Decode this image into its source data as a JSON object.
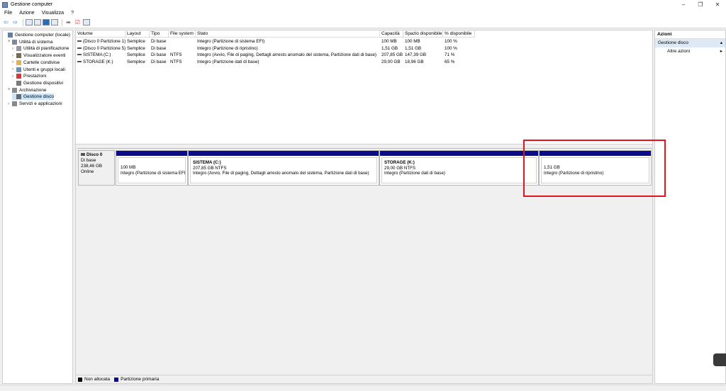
{
  "window": {
    "title": "Gestione computer"
  },
  "menu": [
    "File",
    "Azione",
    "Visualizza",
    "?"
  ],
  "tree": [
    {
      "label": "Gestione computer (locale)",
      "indent": 0,
      "exp": "",
      "color": "#5e7fa6"
    },
    {
      "label": "Utilità di sistema",
      "indent": 1,
      "exp": "˅",
      "color": "#7d8a9c"
    },
    {
      "label": "Utilità di pianificazione",
      "indent": 2,
      "exp": "›",
      "color": "#9a9a9a"
    },
    {
      "label": "Visualizzatore eventi",
      "indent": 2,
      "exp": "›",
      "color": "#7c6b52"
    },
    {
      "label": "Cartelle condivise",
      "indent": 2,
      "exp": "›",
      "color": "#e2b54a"
    },
    {
      "label": "Utenti e gruppi locali",
      "indent": 2,
      "exp": "›",
      "color": "#6a8fb5"
    },
    {
      "label": "Prestazioni",
      "indent": 2,
      "exp": "›",
      "color": "#d23b3b"
    },
    {
      "label": "Gestione dispositivi",
      "indent": 2,
      "exp": "",
      "color": "#7a7a7a"
    },
    {
      "label": "Archiviazione",
      "indent": 1,
      "exp": "˅",
      "color": "#8a8a8a"
    },
    {
      "label": "Gestione disco",
      "indent": 2,
      "exp": "",
      "color": "#6a6a6a",
      "selected": true
    },
    {
      "label": "Servizi e applicazioni",
      "indent": 1,
      "exp": "›",
      "color": "#8a8a8a"
    }
  ],
  "volumes": {
    "headers": [
      "Volume",
      "Layout",
      "Tipo",
      "File system",
      "Stato",
      "Capacità",
      "Spazio disponibile",
      "% disponibile"
    ],
    "rows": [
      [
        "(Disco 0 Partizione 1)",
        "Semplice",
        "Di base",
        "",
        "Integro (Partizione di sistema EFI)",
        "100 MB",
        "100 MB",
        "100 %"
      ],
      [
        "(Disco 0 Partizione 5)",
        "Semplice",
        "Di base",
        "",
        "Integro (Partizione di ripristino)",
        "1,51 GB",
        "1,51 GB",
        "100 %"
      ],
      [
        "SISTEMA (C:)",
        "Semplice",
        "Di base",
        "NTFS",
        "Integro (Avvio, File di paging, Dettagli arresto anomalo del sistema, Partizione dati di base)",
        "207,85 GB",
        "147,39 GB",
        "71 %"
      ],
      [
        "STORAGE (K:)",
        "Semplice",
        "Di base",
        "NTFS",
        "Integro (Partizione dati di base)",
        "29,00 GB",
        "18,96 GB",
        "65 %"
      ]
    ]
  },
  "disk": {
    "name": "Disco 0",
    "type": "Di base",
    "size": "238,46 GB",
    "state": "Online",
    "partitions": [
      {
        "name": "",
        "size": "100 MB",
        "status": "Integro (Partizione di sistema EFI)"
      },
      {
        "name": "SISTEMA  (C:)",
        "size": "207,85 GB NTFS",
        "status": "Integro (Avvio, File di paging, Dettagli arresto anomalo del sistema, Partizione dati di base)"
      },
      {
        "name": "STORAGE  (K:)",
        "size": "29,00 GB NTFS",
        "status": "Integro (Partizione dati di base)"
      },
      {
        "name": "",
        "size": "1,51 GB",
        "status": "Integro (Partizione di ripristino)"
      }
    ]
  },
  "legend": [
    {
      "label": "Non allocata",
      "color": "#000000"
    },
    {
      "label": "Partizione primaria",
      "color": "#0a0a8a"
    }
  ],
  "actions": {
    "title": "Azioni",
    "section": "Gestione disco",
    "items": [
      "Altre azioni"
    ]
  }
}
